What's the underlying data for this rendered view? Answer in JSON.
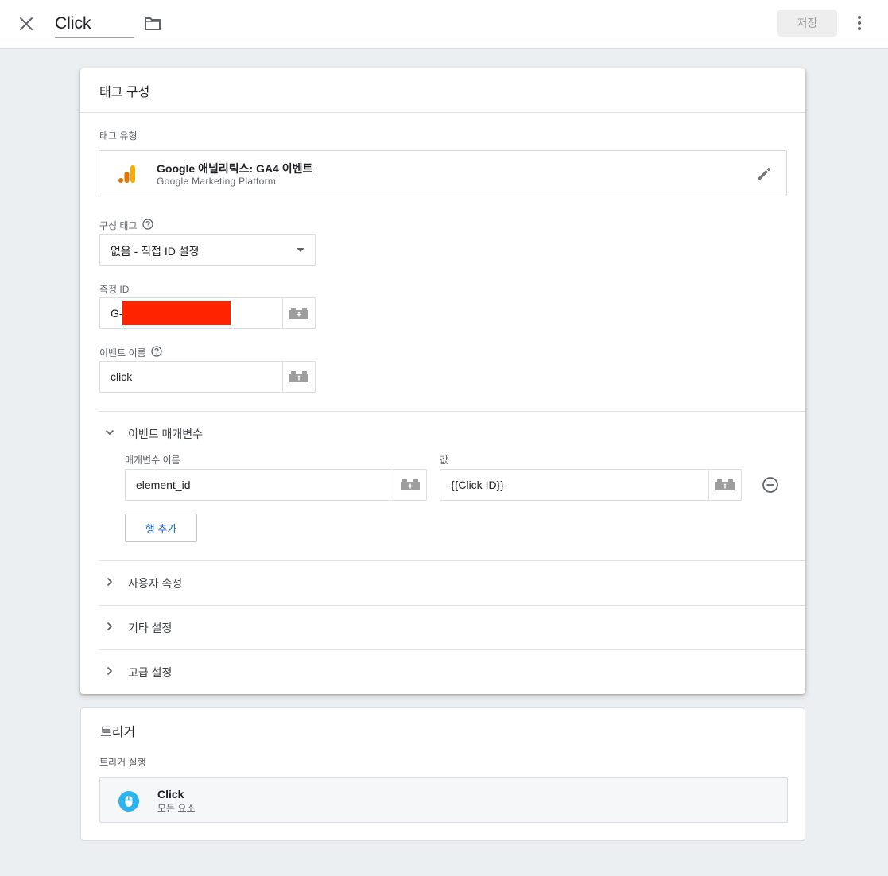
{
  "header": {
    "title": "Click",
    "save_label": "저장"
  },
  "tag_config": {
    "card_title": "태그 구성",
    "tag_type_label": "태그 유형",
    "tag_type": {
      "name": "Google 애널리틱스: GA4 이벤트",
      "provider": "Google Marketing Platform"
    },
    "config_tag_label": "구성 태그",
    "config_tag_value": "없음 - 직접 ID 설정",
    "measurement_id_label": "측정 ID",
    "measurement_id_value": "G-",
    "event_name_label": "이벤트 이름",
    "event_name_value": "click",
    "event_params": {
      "section_label": "이벤트 매개변수",
      "param_name_label": "매개변수 이름",
      "value_label": "값",
      "rows": [
        {
          "name": "element_id",
          "value": "{{Click ID}}"
        }
      ],
      "add_row_label": "행 추가"
    },
    "sections": [
      {
        "label": "사용자 속성"
      },
      {
        "label": "기타 설정"
      },
      {
        "label": "고급 설정"
      }
    ]
  },
  "trigger": {
    "card_title": "트리거",
    "firing_label": "트리거 실행",
    "items": [
      {
        "name": "Click",
        "sub": "모든 요소"
      }
    ]
  },
  "colors": {
    "analytics_orange": "#f9ab00",
    "analytics_dark_orange": "#e37400",
    "trigger_blue": "#2bb3f0",
    "link_blue": "#1967d2",
    "redaction": "#ff2400"
  }
}
